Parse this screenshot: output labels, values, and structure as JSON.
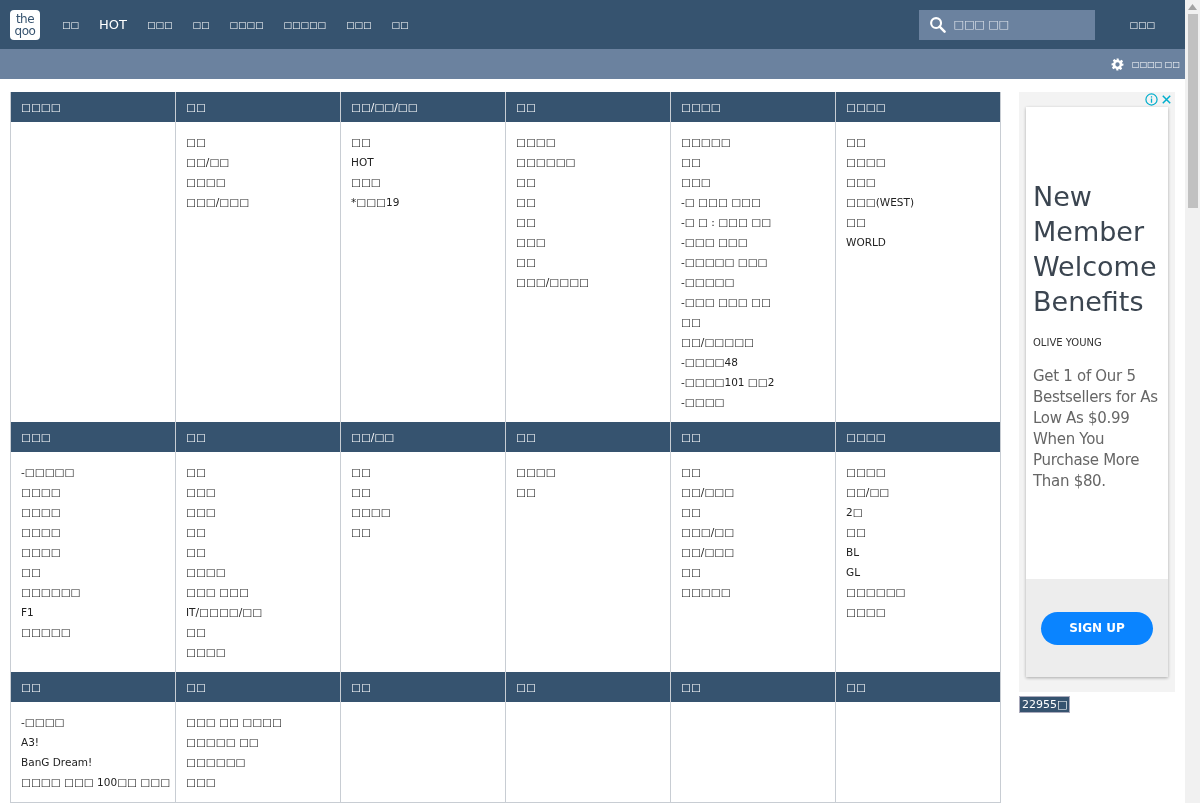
{
  "nav": {
    "logo": {
      "top": "the",
      "bottom": "qoo"
    },
    "items": [
      {
        "label": "□□",
        "selected": false
      },
      {
        "label": "HOT",
        "selected": true
      },
      {
        "label": "□□□",
        "selected": false
      },
      {
        "label": "□□",
        "selected": false
      },
      {
        "label": "□□□□",
        "selected": false
      },
      {
        "label": "□□□□□",
        "selected": false
      },
      {
        "label": "□□□",
        "selected": false
      },
      {
        "label": "□□",
        "selected": false
      }
    ],
    "search": {
      "placeholder": "□□□ □□"
    },
    "right_link": "□□□"
  },
  "subbar": {
    "settings_label": "□□□□ □□"
  },
  "sections": [
    {
      "headers": [
        "□□□□",
        "□□",
        "□□/□□/□□",
        "□□",
        "□□□□",
        "□□□□"
      ],
      "columns": [
        [],
        [
          "□□",
          "□□/□□",
          "□□□□",
          "□□□/□□□"
        ],
        [
          "□□",
          "HOT",
          "□□□",
          "*□□□19"
        ],
        [
          "□□□□",
          "□□□□□□",
          "□□",
          "□□",
          "□□",
          "□□□",
          "□□",
          "□□□/□□□□"
        ],
        [
          "□□□□□",
          "□□",
          "□□□",
          "-□ □□□ □□□",
          "-□ □ : □□□ □□",
          "-□□□ □□□",
          "-□□□□□ □□□",
          "-□□□□□",
          "-□□□ □□□ □□",
          "□□",
          "□□/□□□□□",
          "-□□□□48",
          "-□□□□101 □□2",
          "-□□□□"
        ],
        [
          "□□",
          "□□□□",
          "□□□",
          "□□□(WEST)",
          "□□",
          "WORLD"
        ]
      ]
    },
    {
      "headers": [
        "□□□",
        "□□",
        "□□/□□",
        "□□",
        "□□",
        "□□□□"
      ],
      "columns": [
        [
          "-□□□□□",
          "□□□□",
          "□□□□",
          "□□□□",
          "□□□□",
          "□□",
          "□□□□□□",
          "F1",
          "□□□□□"
        ],
        [
          "□□",
          "□□□",
          "□□□",
          "□□",
          "□□",
          "□□□□",
          "□□□ □□□",
          "IT/□□□□/□□",
          "□□",
          "□□□□"
        ],
        [
          "□□",
          "□□",
          "□□□□",
          "□□"
        ],
        [
          "□□□□",
          "□□"
        ],
        [
          "□□",
          "□□/□□□",
          "□□",
          "□□□/□□",
          "□□/□□□",
          "□□",
          "□□□□□"
        ],
        [
          "□□□□",
          "□□/□□",
          "2□",
          "□□",
          "BL",
          "GL",
          "□□□□□□",
          "□□□□"
        ]
      ]
    },
    {
      "headers": [
        "□□",
        "□□",
        "□□",
        "□□",
        "□□",
        "□□"
      ],
      "columns": [
        [
          "-□□□□",
          "A3!",
          "BanG Dream!",
          "□□□□ □□□ 100□□ □□□"
        ],
        [
          "□□□ □□ □□□□",
          "□□□□□ □□",
          "□□□□□□",
          "□□□"
        ],
        [],
        [],
        [],
        []
      ]
    }
  ],
  "ad": {
    "headline": "New Member Welcome Benefits",
    "brand": "OLIVE YOUNG",
    "body": "Get 1 of Our 5 Bestsellers for As Low As $0.99 When You Purchase More Than $80.",
    "button": "SIGN UP"
  },
  "counter": "22955□"
}
